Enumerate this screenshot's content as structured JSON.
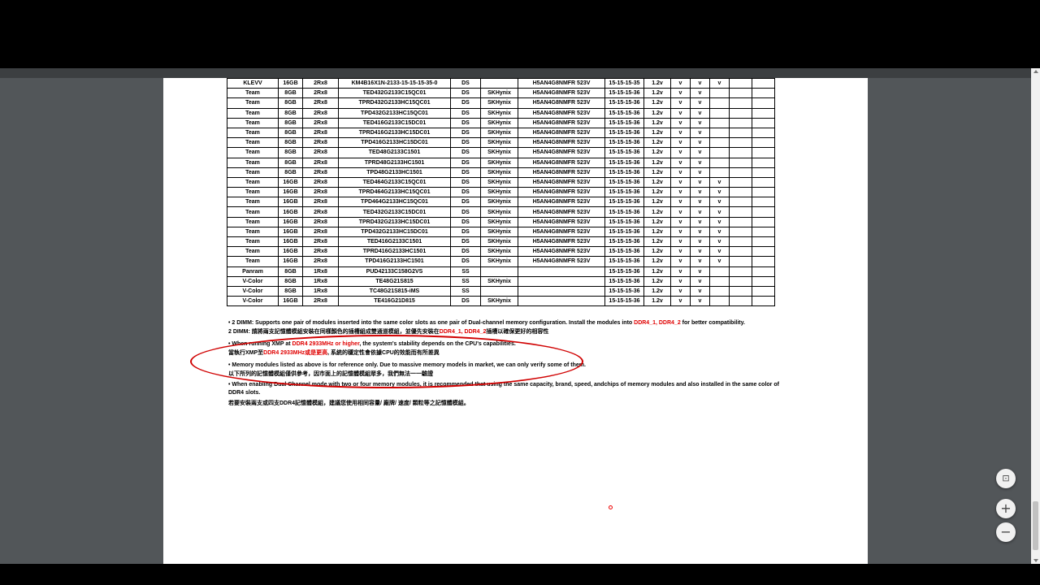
{
  "viewer": {
    "fit_icon": "⊡",
    "zoom_in_icon": "+",
    "zoom_out_icon": "−"
  },
  "table": {
    "rows": [
      [
        "KLEVV",
        "16GB",
        "2Rx8",
        "KM4B16X1N-2133-15-15-15-35-0",
        "DS",
        "",
        "H5AN4G8NMFR 523V",
        "15-15-15-35",
        "1.2v",
        "v",
        "v",
        "v",
        "",
        ""
      ],
      [
        "Team",
        "8GB",
        "2Rx8",
        "TED432G2133C15QC01",
        "DS",
        "SKHynix",
        "H5AN4G8NMFR 523V",
        "15-15-15-36",
        "1.2v",
        "v",
        "v",
        "",
        "",
        ""
      ],
      [
        "Team",
        "8GB",
        "2Rx8",
        "TPRD432G2133HC15QC01",
        "DS",
        "SKHynix",
        "H5AN4G8NMFR 523V",
        "15-15-15-36",
        "1.2v",
        "v",
        "v",
        "",
        "",
        ""
      ],
      [
        "Team",
        "8GB",
        "2Rx8",
        "TPD432G2133HC15QC01",
        "DS",
        "SKHynix",
        "H5AN4G8NMFR 523V",
        "15-15-15-36",
        "1.2v",
        "v",
        "v",
        "",
        "",
        ""
      ],
      [
        "Team",
        "8GB",
        "2Rx8",
        "TED416G2133C15DC01",
        "DS",
        "SKHynix",
        "H5AN4G8NMFR 523V",
        "15-15-15-36",
        "1.2v",
        "v",
        "v",
        "",
        "",
        ""
      ],
      [
        "Team",
        "8GB",
        "2Rx8",
        "TPRD416G2133HC15DC01",
        "DS",
        "SKHynix",
        "H5AN4G8NMFR 523V",
        "15-15-15-36",
        "1.2v",
        "v",
        "v",
        "",
        "",
        ""
      ],
      [
        "Team",
        "8GB",
        "2Rx8",
        "TPD416G2133HC15DC01",
        "DS",
        "SKHynix",
        "H5AN4G8NMFR 523V",
        "15-15-15-36",
        "1.2v",
        "v",
        "v",
        "",
        "",
        ""
      ],
      [
        "Team",
        "8GB",
        "2Rx8",
        "TED48G2133C1501",
        "DS",
        "SKHynix",
        "H5AN4G8NMFR 523V",
        "15-15-15-36",
        "1.2v",
        "v",
        "v",
        "",
        "",
        ""
      ],
      [
        "Team",
        "8GB",
        "2Rx8",
        "TPRD48G2133HC1501",
        "DS",
        "SKHynix",
        "H5AN4G8NMFR 523V",
        "15-15-15-36",
        "1.2v",
        "v",
        "v",
        "",
        "",
        ""
      ],
      [
        "Team",
        "8GB",
        "2Rx8",
        "TPD48G2133HC1501",
        "DS",
        "SKHynix",
        "H5AN4G8NMFR 523V",
        "15-15-15-36",
        "1.2v",
        "v",
        "v",
        "",
        "",
        ""
      ],
      [
        "Team",
        "16GB",
        "2Rx8",
        "TED464G2133C15QC01",
        "DS",
        "SKHynix",
        "H5AN4G8NMFR 523V",
        "15-15-15-36",
        "1.2v",
        "v",
        "v",
        "v",
        "",
        ""
      ],
      [
        "Team",
        "16GB",
        "2Rx8",
        "TPRD464G2133HC15QC01",
        "DS",
        "SKHynix",
        "H5AN4G8NMFR 523V",
        "15-15-15-36",
        "1.2v",
        "v",
        "v",
        "v",
        "",
        ""
      ],
      [
        "Team",
        "16GB",
        "2Rx8",
        "TPD464G2133HC15QC01",
        "DS",
        "SKHynix",
        "H5AN4G8NMFR 523V",
        "15-15-15-36",
        "1.2v",
        "v",
        "v",
        "v",
        "",
        ""
      ],
      [
        "Team",
        "16GB",
        "2Rx8",
        "TED432G2133C15DC01",
        "DS",
        "SKHynix",
        "H5AN4G8NMFR 523V",
        "15-15-15-36",
        "1.2v",
        "v",
        "v",
        "v",
        "",
        ""
      ],
      [
        "Team",
        "16GB",
        "2Rx8",
        "TPRD432G2133HC15DC01",
        "DS",
        "SKHynix",
        "H5AN4G8NMFR 523V",
        "15-15-15-36",
        "1.2v",
        "v",
        "v",
        "v",
        "",
        ""
      ],
      [
        "Team",
        "16GB",
        "2Rx8",
        "TPD432G2133HC15DC01",
        "DS",
        "SKHynix",
        "H5AN4G8NMFR 523V",
        "15-15-15-36",
        "1.2v",
        "v",
        "v",
        "v",
        "",
        ""
      ],
      [
        "Team",
        "16GB",
        "2Rx8",
        "TED416G2133C1501",
        "DS",
        "SKHynix",
        "H5AN4G8NMFR 523V",
        "15-15-15-36",
        "1.2v",
        "v",
        "v",
        "v",
        "",
        ""
      ],
      [
        "Team",
        "16GB",
        "2Rx8",
        "TPRD416G2133HC1501",
        "DS",
        "SKHynix",
        "H5AN4G8NMFR 523V",
        "15-15-15-36",
        "1.2v",
        "v",
        "v",
        "v",
        "",
        ""
      ],
      [
        "Team",
        "16GB",
        "2Rx8",
        "TPD416G2133HC1501",
        "DS",
        "SKHynix",
        "H5AN4G8NMFR 523V",
        "15-15-15-36",
        "1.2v",
        "v",
        "v",
        "v",
        "",
        ""
      ],
      [
        "Panram",
        "8GB",
        "1Rx8",
        "PUD42133C158G2VS",
        "SS",
        "",
        "",
        "15-15-15-36",
        "1.2v",
        "v",
        "v",
        "",
        "",
        ""
      ],
      [
        "V-Color",
        "8GB",
        "1Rx8",
        "TE48G21S815",
        "SS",
        "SKHynix",
        "",
        "15-15-15-36",
        "1.2v",
        "v",
        "v",
        "",
        "",
        ""
      ],
      [
        "V-Color",
        "8GB",
        "1Rx8",
        "TC48G21S815-iMS",
        "SS",
        "",
        "",
        "15-15-15-36",
        "1.2v",
        "v",
        "v",
        "",
        "",
        ""
      ],
      [
        "V-Color",
        "16GB",
        "2Rx8",
        "TE416G21D815",
        "DS",
        "SKHynix",
        "",
        "15-15-15-36",
        "1.2v",
        "v",
        "v",
        "",
        "",
        ""
      ]
    ]
  },
  "notes": {
    "n1_a": "• 2 DIMM: Supports one pair of modules inserted into the same color slots as one pair of Dual-channel memory configuration. Install the modules into ",
    "n1_red": "DDR4_1, DDR4_2",
    "n1_b": " for better compatibility.",
    "n1_zh_a": "2 DIMM: 請將兩支記憶體模組安裝在同樣顏色的插槽組成雙通道模組，並優先安裝在",
    "n1_zh_red": "DDR4_1, DDR4_2",
    "n1_zh_b": "插槽以確保更好的相容性",
    "n2_a": "• When running XMP at ",
    "n2_red": "DDR4 2933MHz or higher",
    "n2_b": ", the system's stability depends on the CPU's capabilities.",
    "n2_zh_a": "當執行XMP至",
    "n2_zh_red": "DDR4 2933MHz或是更高",
    "n2_zh_b": ", 系統的穩定性會依據CPU的效能而有所差異",
    "n3": "• Memory modules listed as above is for reference only. Due to massive memory models in market, we can only verify some of them.",
    "n3_zh": "以下所列的記憶體模組僅供參考，因市面上的記憶體模組眾多，我們無法一一驗證",
    "n4": "• When enabling Dual Channel mode with two or four memory modules, it is recommended that using the same capacity, brand, speed, andchips of memory modules and also installed in the same color of DDR4 slots.",
    "n4_zh": "若要安裝兩支或四支DDR4記憶體模組，建議您使用相同容量/ 廠牌/ 速度/ 顆粒等之記憶體模組。"
  },
  "colors": {
    "accent_red": "#e00000",
    "annotation_red": "#d00000"
  }
}
